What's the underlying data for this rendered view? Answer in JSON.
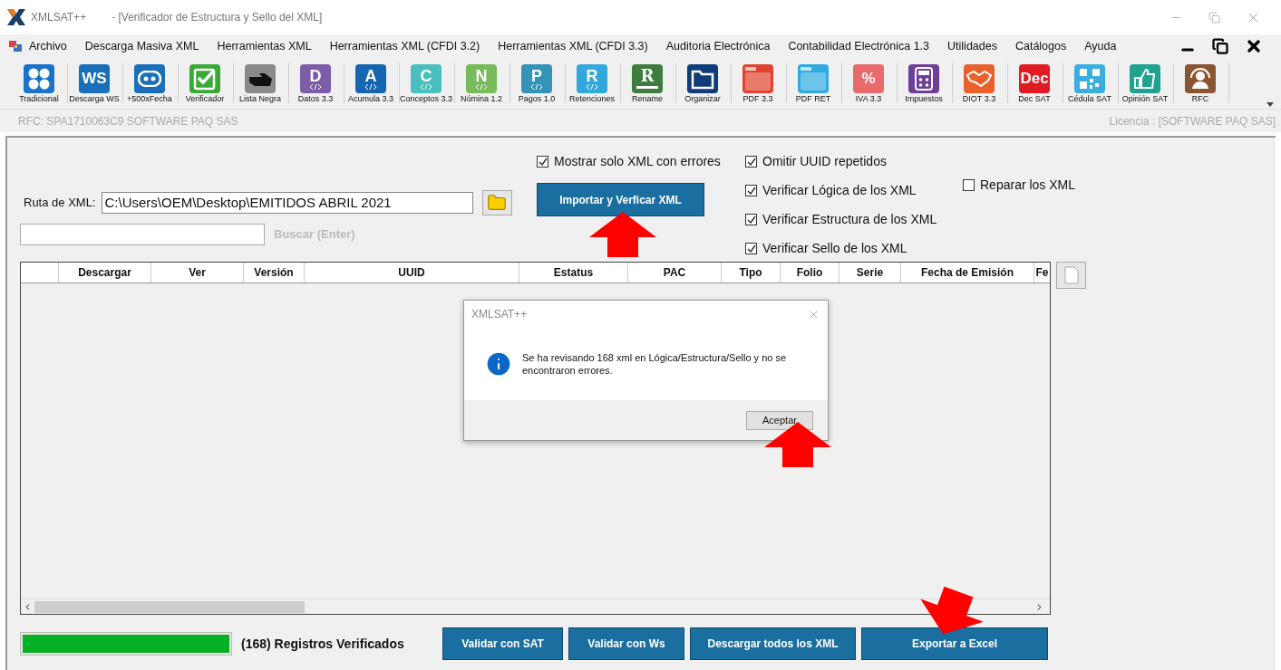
{
  "window": {
    "app_name": "XMLSAT++",
    "title": "- [Verificador de Estructura y Sello del XML]"
  },
  "menu": [
    "Archivo",
    "Descarga Masiva XML",
    "Herramientas XML",
    "Herramientas XML (CFDI 3.2)",
    "Herramientas XML (CFDI 3.3)",
    "Auditoria Electrónica",
    "Contabilidad Electrónica 1.3",
    "Utilidades",
    "Catálogos",
    "Ayuda"
  ],
  "toolbar": [
    {
      "label": "Tradicional",
      "kind": "circles",
      "color": "#1a73c9"
    },
    {
      "label": "Descarga WS",
      "kind": "letters",
      "glyph": "WS",
      "color": "#1a6fb8"
    },
    {
      "label": "+500xFecha",
      "kind": "robot",
      "color": "#1a6fb8"
    },
    {
      "label": "Verificador",
      "kind": "check",
      "color": "#3aa935"
    },
    {
      "label": "Lista Negra",
      "kind": "glove",
      "color": "#8a8a8a"
    },
    {
      "label": "Datos 3.3",
      "kind": "code",
      "glyph": "D",
      "color": "#7b5ea7"
    },
    {
      "label": "Acumula 3.3",
      "kind": "code",
      "glyph": "A",
      "color": "#1565b0"
    },
    {
      "label": "Conceptos 3.3",
      "kind": "code",
      "glyph": "C",
      "color": "#4bbfbf"
    },
    {
      "label": "Nómina 1.2",
      "kind": "code",
      "glyph": "N",
      "color": "#78bb5a"
    },
    {
      "label": "Pagos 1.0",
      "kind": "code",
      "glyph": "P",
      "color": "#3593b8"
    },
    {
      "label": "Retenciones",
      "kind": "code",
      "glyph": "R",
      "color": "#33a8dc"
    },
    {
      "label": "Rename",
      "kind": "underline",
      "glyph": "R",
      "color": "#3d7d3d"
    },
    {
      "label": "Organizar",
      "kind": "folder",
      "color": "#0f3d7a"
    },
    {
      "label": "PDF 3.3",
      "kind": "pdf",
      "color": "#e0432f"
    },
    {
      "label": "PDF RET",
      "kind": "pdf",
      "color": "#2fa9df"
    },
    {
      "label": "IVA 3.3",
      "kind": "letters",
      "glyph": "%",
      "color": "#e86a6a"
    },
    {
      "label": "Impuestos",
      "kind": "calculator",
      "color": "#6f3f97"
    },
    {
      "label": "DIOT 3.3",
      "kind": "handshake",
      "color": "#e8602c"
    },
    {
      "label": "Dec SAT",
      "kind": "letters",
      "glyph": "Dec",
      "color": "#e01b24"
    },
    {
      "label": "Cédula SAT",
      "kind": "qr",
      "color": "#3aaee0"
    },
    {
      "label": "Opinión SAT",
      "kind": "thumb",
      "color": "#1fa390"
    },
    {
      "label": "RFC",
      "kind": "person",
      "color": "#8a5530"
    }
  ],
  "status": {
    "rfc": "RFC: SPA1710063C9 SOFTWARE PAQ SAS",
    "license": "Licencia : [SOFTWARE PAQ SAS]"
  },
  "form": {
    "path_label": "Ruta de XML:",
    "path_value": "C:\\Users\\OEM\\Desktop\\EMITIDOS ABRIL 2021",
    "search_label": "Buscar (Enter)",
    "import_button": "Importar  y Verficar XML"
  },
  "options": [
    {
      "label": "Mostrar solo XML con errores",
      "checked": true
    },
    {
      "label": "Omitir UUID repetidos",
      "checked": true
    },
    {
      "label": "Verificar Lógica de los XML",
      "checked": true
    },
    {
      "label": "Verificar Estructura de los XML",
      "checked": true
    },
    {
      "label": "Verificar Sello de los XML",
      "checked": true
    },
    {
      "label": "Reparar los XML",
      "checked": false
    }
  ],
  "table": {
    "columns": [
      "",
      "Descargar",
      "Ver",
      "Versión",
      "UUID",
      "Estatus",
      "PAC",
      "Tipo",
      "Folio",
      "Serie",
      "Fecha de Emisión",
      "Fe"
    ]
  },
  "dialog": {
    "title": "XMLSAT++",
    "message": "Se ha revisando 168 xml en Lógica/Estructura/Sello y no se encontraron errores.",
    "button": "Aceptar"
  },
  "footer": {
    "progress": {
      "level": 1.0
    },
    "status": "(168) Registros Verificados",
    "buttons": [
      "Validar con SAT",
      "Validar con Ws",
      "Descargar todos los XML",
      "Exportar  a Excel"
    ]
  }
}
